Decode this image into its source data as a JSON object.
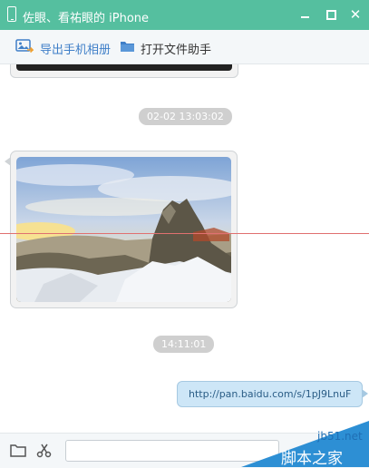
{
  "window": {
    "title": "佐眼、看祐眼的 iPhone",
    "minimize_icon": "minimize-icon",
    "maximize_icon": "maximize-icon",
    "close_icon": "close-icon",
    "close_glyph": "✕"
  },
  "toolbar": {
    "export_label": "导出手机相册",
    "export_icon": "photo-export-icon",
    "helper_label": "打开文件助手",
    "helper_icon": "folder-icon"
  },
  "chat": {
    "messages": [
      {
        "type": "timestamp",
        "text": "02-02 13:03:02"
      },
      {
        "type": "image",
        "side": "left",
        "description_icon": "mountain-photo"
      },
      {
        "type": "timestamp",
        "text": "14:11:01"
      },
      {
        "type": "link",
        "side": "right",
        "text": "http://pan.baidu.com/s/1pJ9LnuF"
      }
    ]
  },
  "bottom": {
    "folder_icon": "folder-icon",
    "scissors_icon": "scissors-icon",
    "input_value": "",
    "input_placeholder": ""
  },
  "watermark": {
    "domain": "jb51.net",
    "brand": "脚本之家"
  },
  "colors": {
    "titlebar": "#55bf9f",
    "toolbar_bg": "#f4f7f9",
    "link_bubble": "#cde6f7",
    "timestamp_bg": "#cfcfcf",
    "accent_blue": "#3f7fc8"
  }
}
